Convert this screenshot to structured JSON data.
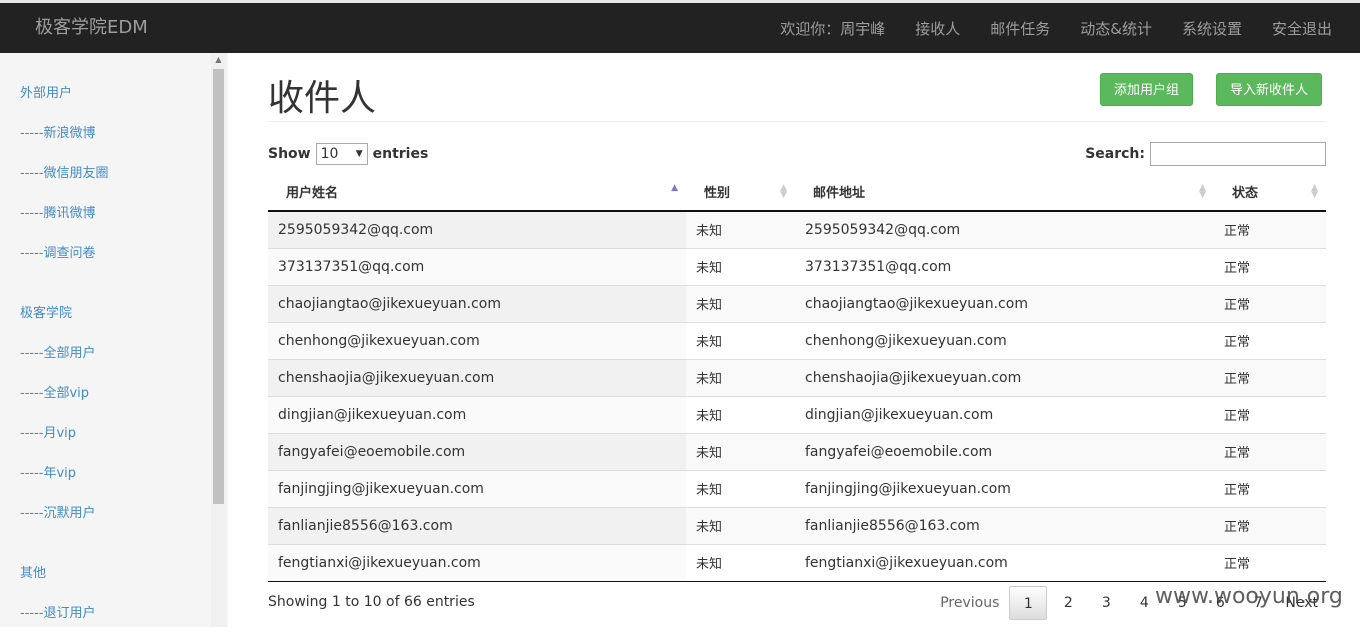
{
  "navbar": {
    "brand": "极客学院EDM",
    "items": [
      "欢迎你：周宇峰",
      "接收人",
      "邮件任务",
      "动态&统计",
      "系统设置",
      "安全退出"
    ]
  },
  "sidebar": {
    "groups": [
      {
        "title": "外部用户",
        "items": [
          "-----新浪微博",
          "-----微信朋友圈",
          "-----腾讯微博",
          "-----调查问卷"
        ]
      },
      {
        "title": "极客学院",
        "items": [
          "-----全部用户",
          "-----全部vip",
          "-----月vip",
          "-----年vip",
          "-----沉默用户"
        ]
      },
      {
        "title": "其他",
        "items": [
          "-----退订用户"
        ]
      }
    ]
  },
  "main": {
    "title": "收件人",
    "add_group_label": "添加用户组",
    "import_label": "导入新收件人",
    "show_label": "Show",
    "entries_label": "entries",
    "page_length": "10",
    "search_label": "Search:",
    "search_value": "",
    "columns": [
      "用户姓名",
      "性别",
      "邮件地址",
      "状态"
    ],
    "rows": [
      [
        "2595059342@qq.com",
        "未知",
        "2595059342@qq.com",
        "正常"
      ],
      [
        "373137351@qq.com",
        "未知",
        "373137351@qq.com",
        "正常"
      ],
      [
        "chaojiangtao@jikexueyuan.com",
        "未知",
        "chaojiangtao@jikexueyuan.com",
        "正常"
      ],
      [
        "chenhong@jikexueyuan.com",
        "未知",
        "chenhong@jikexueyuan.com",
        "正常"
      ],
      [
        "chenshaojia@jikexueyuan.com",
        "未知",
        "chenshaojia@jikexueyuan.com",
        "正常"
      ],
      [
        "dingjian@jikexueyuan.com",
        "未知",
        "dingjian@jikexueyuan.com",
        "正常"
      ],
      [
        "fangyafei@eoemobile.com",
        "未知",
        "fangyafei@eoemobile.com",
        "正常"
      ],
      [
        "fanjingjing@jikexueyuan.com",
        "未知",
        "fanjingjing@jikexueyuan.com",
        "正常"
      ],
      [
        "fanlianjie8556@163.com",
        "未知",
        "fanlianjie8556@163.com",
        "正常"
      ],
      [
        "fengtianxi@jikexueyuan.com",
        "未知",
        "fengtianxi@jikexueyuan.com",
        "正常"
      ]
    ],
    "info": "Showing 1 to 10 of 66 entries",
    "pager": {
      "previous": "Previous",
      "pages": [
        "1",
        "2",
        "3",
        "4",
        "5",
        "6",
        "7"
      ],
      "next": "Next",
      "current": "1"
    }
  },
  "watermark": "www.wooyun.org"
}
